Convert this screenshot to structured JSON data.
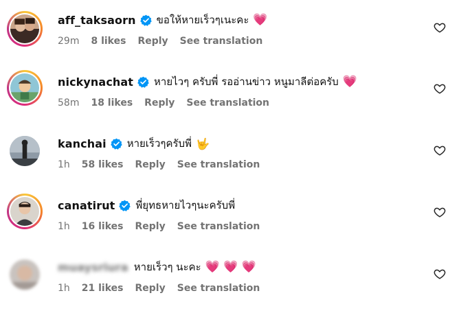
{
  "comments": [
    {
      "username": "aff_taksaorn",
      "text": "ขอให้หายเร็วๆเนะคะ",
      "emoji": "💗",
      "time": "29m",
      "likes": "8 likes",
      "reply": "Reply",
      "translate": "See translation"
    },
    {
      "username": "nickynachat",
      "text": "หายไวๆ ครับพี่ รออ่านข่าว หนูมาลีต่อครับ",
      "emoji": "💗",
      "time": "58m",
      "likes": "18 likes",
      "reply": "Reply",
      "translate": "See translation"
    },
    {
      "username": "kanchai",
      "text": "หายเร็วๆครับพี่",
      "emoji": "🤟",
      "time": "1h",
      "likes": "58 likes",
      "reply": "Reply",
      "translate": "See translation"
    },
    {
      "username": "canatirut",
      "text": "พี่ยุทธหายไวๆนะครับพี่",
      "emoji": "",
      "time": "1h",
      "likes": "16 likes",
      "reply": "Reply",
      "translate": "See translation"
    },
    {
      "username": "muaysriura",
      "text": "หายเร็วๆ นะคะ",
      "emoji": "💗 💗 💗",
      "time": "1h",
      "likes": "21 likes",
      "reply": "Reply",
      "translate": "See translation"
    }
  ],
  "colors": {
    "verified": "#0095f6",
    "heart": "#e8285c",
    "meta": "#737373"
  },
  "icons": {
    "verified": "verified-badge-icon",
    "like": "heart-outline-icon"
  }
}
